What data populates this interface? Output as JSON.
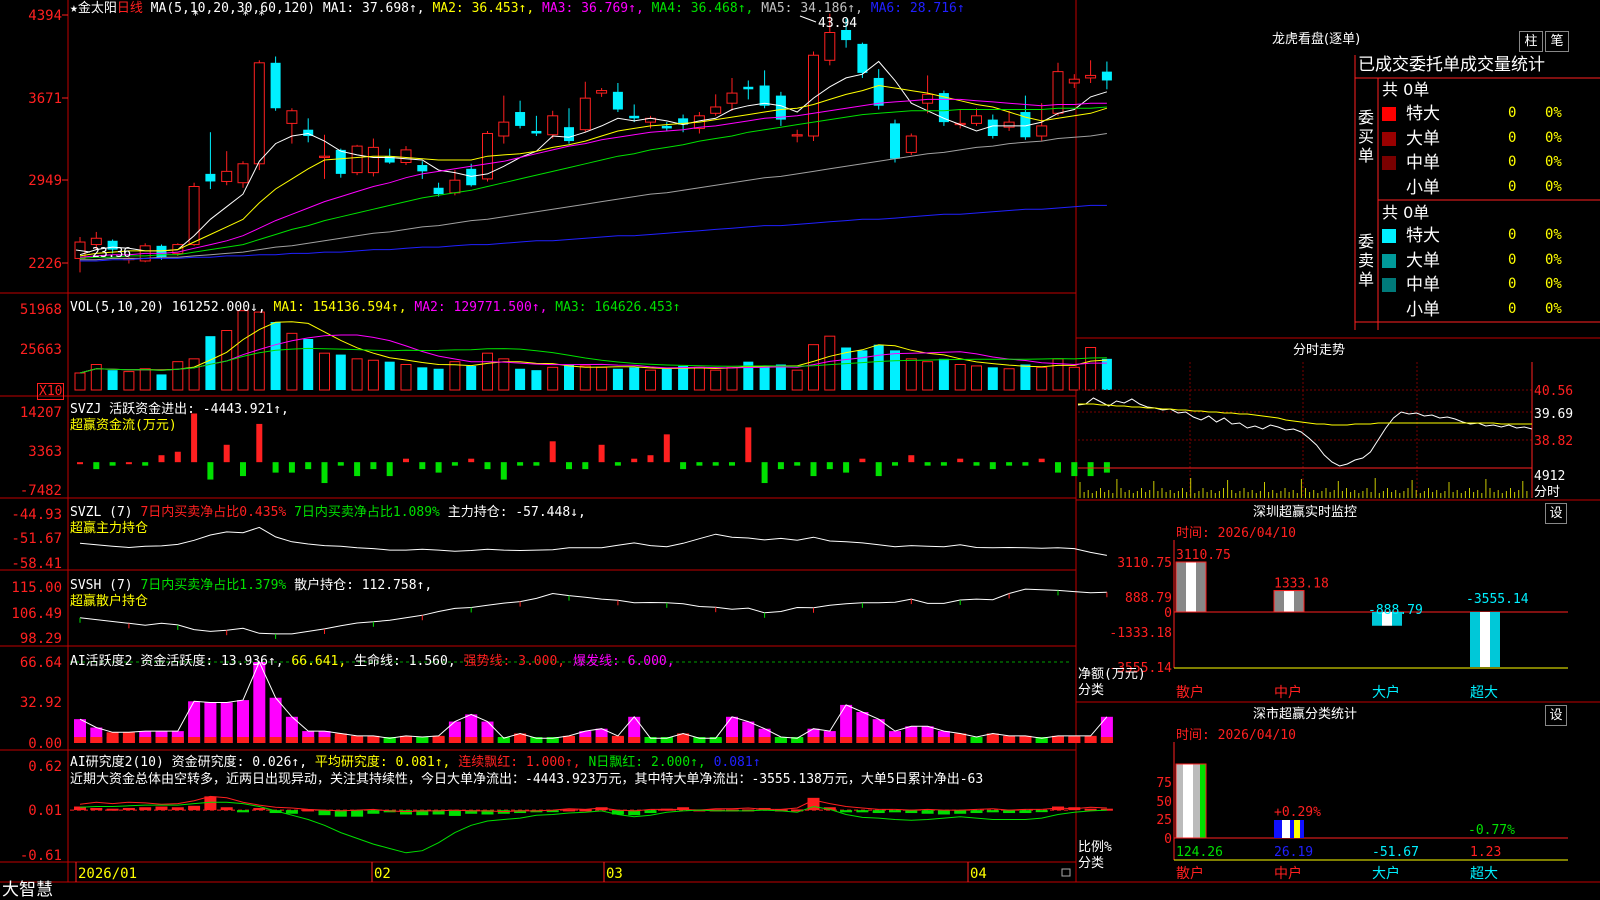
{
  "colors": {
    "red": "#ff2020",
    "cyan": "#00f0ff",
    "green": "#00e000",
    "yellow": "#ffff00",
    "magenta": "#ff00ff",
    "white": "#ffffff",
    "gray": "#a0a0a0",
    "blue": "#2020ff",
    "border": "#c00000"
  },
  "kline": {
    "title": "★金太阳",
    "period": "日线",
    "ma_label": "MA(5,10,20,30,60,120)",
    "ma1": "MA1: 37.698↑,",
    "ma2": "MA2: 36.453↑,",
    "ma3": "MA3: 36.769↑,",
    "ma4": "MA4: 36.468↑,",
    "ma5": "MA5: 34.186↑,",
    "ma6": "MA6: 28.716↑",
    "y_ticks": [
      "4394",
      "3671",
      "2949",
      "2226"
    ],
    "high_mark": "43.94",
    "low_mark": "23.36",
    "candles": [
      {
        "o": 24.5,
        "c": 25.8,
        "h": 26.2,
        "l": 23.4
      },
      {
        "o": 25.6,
        "c": 26.1,
        "h": 26.6,
        "l": 25.2
      },
      {
        "o": 25.9,
        "c": 25.2,
        "h": 26.0,
        "l": 24.9
      },
      {
        "o": 24.4,
        "c": 24.5,
        "h": 24.6,
        "l": 24.1
      },
      {
        "o": 24.3,
        "c": 25.5,
        "h": 25.7,
        "l": 24.2
      },
      {
        "o": 25.5,
        "c": 24.6,
        "h": 25.6,
        "l": 24.4
      },
      {
        "o": 24.9,
        "c": 25.6,
        "h": 25.7,
        "l": 24.7
      },
      {
        "o": 25.6,
        "c": 30.2,
        "h": 30.5,
        "l": 25.5
      },
      {
        "o": 31.2,
        "c": 30.6,
        "h": 34.5,
        "l": 30.0
      },
      {
        "o": 30.6,
        "c": 31.4,
        "h": 33.0,
        "l": 30.3
      },
      {
        "o": 30.5,
        "c": 32.0,
        "h": 32.2,
        "l": 30.1
      },
      {
        "o": 32.0,
        "c": 40.0,
        "h": 40.2,
        "l": 31.5
      },
      {
        "o": 40.0,
        "c": 36.4,
        "h": 40.5,
        "l": 36.2
      },
      {
        "o": 35.2,
        "c": 36.2,
        "h": 36.4,
        "l": 33.6
      },
      {
        "o": 34.7,
        "c": 34.2,
        "h": 35.6,
        "l": 33.7
      },
      {
        "o": 32.5,
        "c": 32.6,
        "h": 34.3,
        "l": 30.8
      },
      {
        "o": 33.1,
        "c": 31.2,
        "h": 33.2,
        "l": 30.9
      },
      {
        "o": 31.3,
        "c": 33.4,
        "h": 33.5,
        "l": 31.1
      },
      {
        "o": 31.3,
        "c": 33.3,
        "h": 34.0,
        "l": 31.0
      },
      {
        "o": 32.6,
        "c": 32.1,
        "h": 33.2,
        "l": 32.0
      },
      {
        "o": 32.1,
        "c": 33.1,
        "h": 33.4,
        "l": 31.9
      },
      {
        "o": 31.9,
        "c": 31.4,
        "h": 32.2,
        "l": 30.8
      },
      {
        "o": 30.1,
        "c": 29.6,
        "h": 30.5,
        "l": 29.4
      },
      {
        "o": 29.7,
        "c": 30.7,
        "h": 31.5,
        "l": 29.5
      },
      {
        "o": 31.6,
        "c": 30.3,
        "h": 32.0,
        "l": 30.2
      },
      {
        "o": 30.8,
        "c": 34.4,
        "h": 34.6,
        "l": 30.6
      },
      {
        "o": 34.2,
        "c": 35.3,
        "h": 37.4,
        "l": 33.6
      },
      {
        "o": 36.1,
        "c": 35.0,
        "h": 37.0,
        "l": 34.8
      },
      {
        "o": 34.6,
        "c": 34.4,
        "h": 35.8,
        "l": 34.2
      },
      {
        "o": 34.3,
        "c": 35.8,
        "h": 36.2,
        "l": 34.0
      },
      {
        "o": 34.9,
        "c": 33.8,
        "h": 36.4,
        "l": 33.6
      },
      {
        "o": 34.7,
        "c": 37.2,
        "h": 38.5,
        "l": 34.5
      },
      {
        "o": 37.6,
        "c": 37.8,
        "h": 38.0,
        "l": 37.3
      },
      {
        "o": 37.7,
        "c": 36.3,
        "h": 38.4,
        "l": 36.1
      },
      {
        "o": 35.8,
        "c": 35.6,
        "h": 36.7,
        "l": 35.3
      },
      {
        "o": 35.3,
        "c": 35.6,
        "h": 35.8,
        "l": 34.8
      },
      {
        "o": 35.0,
        "c": 34.8,
        "h": 35.3,
        "l": 34.6
      },
      {
        "o": 35.6,
        "c": 35.1,
        "h": 35.9,
        "l": 34.5
      },
      {
        "o": 34.8,
        "c": 35.8,
        "h": 36.1,
        "l": 34.4
      },
      {
        "o": 36.0,
        "c": 36.5,
        "h": 37.5,
        "l": 35.8
      },
      {
        "o": 36.8,
        "c": 37.6,
        "h": 38.8,
        "l": 36.2
      },
      {
        "o": 38.1,
        "c": 37.9,
        "h": 38.6,
        "l": 37.1
      },
      {
        "o": 38.2,
        "c": 36.6,
        "h": 39.4,
        "l": 36.4
      },
      {
        "o": 37.4,
        "c": 35.5,
        "h": 37.7,
        "l": 35.0
      },
      {
        "o": 34.2,
        "c": 34.3,
        "h": 34.7,
        "l": 33.7
      },
      {
        "o": 34.2,
        "c": 40.6,
        "h": 40.9,
        "l": 33.8
      },
      {
        "o": 40.2,
        "c": 42.4,
        "h": 43.9,
        "l": 39.8
      },
      {
        "o": 42.6,
        "c": 41.8,
        "h": 43.5,
        "l": 41.2
      },
      {
        "o": 41.5,
        "c": 39.2,
        "h": 41.6,
        "l": 38.8
      },
      {
        "o": 38.8,
        "c": 36.6,
        "h": 39.5,
        "l": 36.3
      },
      {
        "o": 35.2,
        "c": 32.4,
        "h": 35.5,
        "l": 32.1
      },
      {
        "o": 32.9,
        "c": 34.2,
        "h": 34.4,
        "l": 32.7
      },
      {
        "o": 36.8,
        "c": 37.5,
        "h": 39.0,
        "l": 36.0
      },
      {
        "o": 37.6,
        "c": 35.3,
        "h": 37.8,
        "l": 35.0
      },
      {
        "o": 35.1,
        "c": 35.2,
        "h": 36.3,
        "l": 34.8
      },
      {
        "o": 35.2,
        "c": 35.8,
        "h": 36.4,
        "l": 35.0
      },
      {
        "o": 35.5,
        "c": 34.2,
        "h": 35.9,
        "l": 34.0
      },
      {
        "o": 34.9,
        "c": 35.3,
        "h": 36.2,
        "l": 34.6
      },
      {
        "o": 36.1,
        "c": 34.1,
        "h": 37.4,
        "l": 33.9
      },
      {
        "o": 34.2,
        "c": 35.0,
        "h": 36.8,
        "l": 33.8
      },
      {
        "o": 36.0,
        "c": 39.3,
        "h": 40.0,
        "l": 35.8
      },
      {
        "o": 38.4,
        "c": 38.7,
        "h": 39.1,
        "l": 38.0
      },
      {
        "o": 38.8,
        "c": 39.0,
        "h": 40.2,
        "l": 38.4
      },
      {
        "o": 39.3,
        "c": 38.6,
        "h": 40.1,
        "l": 37.9
      }
    ],
    "ma_lines": {
      "ma5": [
        24.8,
        25.2,
        25.4,
        25.3,
        25.1,
        25.1,
        25.2,
        26.3,
        27.6,
        28.6,
        29.6,
        32.2,
        33.6,
        34.2,
        34.4,
        33.8,
        33.0,
        32.7,
        32.5,
        32.5,
        32.4,
        32.3,
        31.5,
        31.3,
        31.0,
        31.2,
        31.8,
        32.5,
        33.0,
        34.2,
        34.1,
        34.5,
        35.0,
        35.6,
        35.4,
        35.6,
        35.4,
        35.1,
        35.4,
        35.6,
        36.3,
        36.6,
        36.8,
        36.6,
        36.1,
        37.2,
        38.1,
        38.8,
        39.1,
        40.1,
        38.6,
        36.8,
        36.2,
        35.6,
        35.1,
        34.6,
        35.0,
        35.0,
        35.0,
        35.3,
        36.0,
        36.3,
        37.3,
        37.7
      ],
      "ma10": [
        24.7,
        24.9,
        25.0,
        25.1,
        25.1,
        25.1,
        25.2,
        25.8,
        26.4,
        27.0,
        27.6,
        28.9,
        30.0,
        30.8,
        31.6,
        32.3,
        32.4,
        32.5,
        32.6,
        32.6,
        32.5,
        32.4,
        32.3,
        32.3,
        32.3,
        32.6,
        32.7,
        32.8,
        33.0,
        33.3,
        33.5,
        33.8,
        34.2,
        34.6,
        34.8,
        35.0,
        35.1,
        35.2,
        35.3,
        35.5,
        35.7,
        35.9,
        36.1,
        36.3,
        36.4,
        36.7,
        37.1,
        37.5,
        37.8,
        38.2,
        38.0,
        37.8,
        37.6,
        37.3,
        37.0,
        36.7,
        36.5,
        36.1,
        35.7,
        35.4,
        35.6,
        35.8,
        36.0,
        36.4
      ],
      "ma20": [
        24.6,
        24.7,
        24.8,
        24.8,
        24.9,
        24.9,
        25.0,
        25.3,
        25.6,
        25.9,
        26.3,
        26.9,
        27.5,
        28.0,
        28.5,
        29.0,
        29.4,
        29.8,
        30.2,
        30.5,
        30.9,
        31.2,
        31.4,
        31.6,
        31.8,
        32.0,
        32.2,
        32.5,
        32.8,
        33.1,
        33.4,
        33.6,
        33.9,
        34.1,
        34.3,
        34.5,
        34.6,
        34.7,
        34.9,
        35.0,
        35.2,
        35.4,
        35.6,
        35.7,
        35.8,
        36.0,
        36.2,
        36.4,
        36.6,
        36.8,
        36.9,
        37.0,
        37.1,
        37.1,
        37.1,
        37.0,
        36.9,
        36.8,
        36.7,
        36.6,
        36.7,
        36.7,
        36.8,
        36.8
      ],
      "ma30": [
        24.5,
        24.6,
        24.6,
        24.7,
        24.7,
        24.8,
        24.8,
        25.0,
        25.2,
        25.4,
        25.6,
        26.0,
        26.4,
        26.8,
        27.1,
        27.5,
        27.8,
        28.1,
        28.4,
        28.7,
        29.0,
        29.3,
        29.5,
        29.7,
        29.9,
        30.2,
        30.5,
        30.8,
        31.1,
        31.4,
        31.7,
        32.0,
        32.3,
        32.6,
        32.8,
        33.1,
        33.3,
        33.5,
        33.8,
        34.0,
        34.2,
        34.5,
        34.7,
        34.9,
        35.1,
        35.3,
        35.5,
        35.7,
        35.9,
        36.0,
        36.1,
        36.2,
        36.2,
        36.2,
        36.3,
        36.3,
        36.3,
        36.3,
        36.3,
        36.3,
        36.4,
        36.4,
        36.4,
        36.5
      ],
      "ma60": [
        24.4,
        24.4,
        24.5,
        24.5,
        24.5,
        24.6,
        24.6,
        24.7,
        24.8,
        24.9,
        25.0,
        25.2,
        25.4,
        25.5,
        25.7,
        25.9,
        26.1,
        26.3,
        26.5,
        26.6,
        26.8,
        27.0,
        27.1,
        27.3,
        27.5,
        27.6,
        27.8,
        28.0,
        28.2,
        28.4,
        28.6,
        28.8,
        29.0,
        29.2,
        29.4,
        29.6,
        29.7,
        29.9,
        30.1,
        30.3,
        30.5,
        30.7,
        30.9,
        31.0,
        31.2,
        31.4,
        31.6,
        31.8,
        32.0,
        32.2,
        32.4,
        32.6,
        32.8,
        32.9,
        33.1,
        33.3,
        33.4,
        33.6,
        33.7,
        33.8,
        34.0,
        34.1,
        34.2,
        34.4
      ],
      "ma120": [
        24.3,
        24.3,
        24.4,
        24.4,
        24.5,
        24.5,
        24.5,
        24.6,
        24.6,
        24.7,
        24.7,
        24.8,
        24.8,
        24.9,
        24.9,
        25.0,
        25.0,
        25.1,
        25.2,
        25.2,
        25.3,
        25.4,
        25.4,
        25.5,
        25.6,
        25.6,
        25.7,
        25.8,
        25.9,
        25.9,
        26.0,
        26.1,
        26.2,
        26.3,
        26.3,
        26.4,
        26.5,
        26.6,
        26.7,
        26.8,
        26.9,
        27.0,
        27.1,
        27.1,
        27.2,
        27.3,
        27.4,
        27.5,
        27.6,
        27.6,
        27.7,
        27.8,
        27.9,
        28.0,
        28.0,
        28.1,
        28.2,
        28.3,
        28.4,
        28.4,
        28.5,
        28.6,
        28.7,
        28.7
      ]
    }
  },
  "volume": {
    "label": "VOL(5,10,20)",
    "value": "161252.000↓,",
    "ma1": "MA1: 154136.594↑,",
    "ma2": "MA2: 129771.500↑,",
    "ma3": "MA3: 164626.453↑",
    "y_ticks": [
      "51968",
      "25663"
    ],
    "unit": "X10",
    "bars": [
      12,
      18,
      14,
      13,
      15,
      11,
      20,
      22,
      38,
      42,
      56,
      55,
      48,
      40,
      36,
      26,
      25,
      22,
      21,
      20,
      18,
      16,
      15,
      20,
      17,
      26,
      22,
      15,
      14,
      16,
      18,
      17,
      16,
      15,
      16,
      14,
      15,
      17,
      16,
      14,
      16,
      20,
      17,
      18,
      14,
      32,
      38,
      30,
      28,
      32,
      28,
      22,
      20,
      22,
      18,
      17,
      16,
      15,
      18,
      16,
      22,
      16,
      30,
      22
    ]
  },
  "svzj": {
    "label": "SVZJ",
    "name": "活跃资金进出: -4443.921↑,",
    "sub": "超赢资金流(万元)",
    "y_ticks": [
      "14207",
      "3363",
      "-7482"
    ],
    "bars": [
      0,
      -2,
      -1,
      0,
      -1,
      2,
      3,
      14,
      -5,
      5,
      -4,
      11,
      -3,
      -3,
      -2,
      -6,
      -1,
      -4,
      -2,
      -4,
      1,
      -2,
      -3,
      -1,
      1,
      -2,
      -5,
      -1,
      -1,
      6,
      -2,
      -2,
      5,
      -1,
      1,
      2,
      8,
      -2,
      -1,
      -1,
      -1,
      10,
      -6,
      -2,
      -1,
      -4,
      -2,
      -3,
      1,
      -4,
      -1,
      2,
      -1,
      -1,
      1,
      -1,
      -2,
      -1,
      -1,
      1,
      -3,
      -4,
      -4,
      -3
    ]
  },
  "svzl": {
    "label": "SVZL (7)",
    "part1": "7日内买卖净占比0.435%",
    "part2": "7日内买卖净占比1.089%",
    "part3": "主力持仓: -57.448↓,",
    "sub": "超赢主力持仓",
    "y_ticks": [
      "-44.93",
      "-51.67",
      "-58.41"
    ],
    "line": [
      -53.2,
      -53.6,
      -54.0,
      -54.3,
      -54.0,
      -53.9,
      -53.5,
      -52.4,
      -51.0,
      -50.2,
      -50.4,
      -49.0,
      -51.5,
      -52.8,
      -53.4,
      -53.8,
      -54.0,
      -54.4,
      -54.6,
      -55.0,
      -55.0,
      -54.8,
      -55.0,
      -55.3,
      -55.1,
      -54.8,
      -55.0,
      -55.1,
      -55.0,
      -54.9,
      -54.4,
      -54.4,
      -54.4,
      -53.7,
      -53.1,
      -53.8,
      -54.1,
      -53.2,
      -52.0,
      -50.8,
      -51.6,
      -51.8,
      -52.3,
      -51.9,
      -52.4,
      -51.6,
      -52.6,
      -52.8,
      -53.1,
      -53.6,
      -54.1,
      -53.8,
      -54.0,
      -54.1,
      -53.6,
      -54.3,
      -54.4,
      -54.3,
      -54.4,
      -54.5,
      -54.4,
      -54.6,
      -55.6,
      -56.4
    ]
  },
  "svsh": {
    "label": "SVSH (7)",
    "part1": "7日内买卖净占比1.379%",
    "part2": "散户持仓: 112.758↑,",
    "sub": "超赢散户持仓",
    "y_ticks": [
      "115.00",
      "106.49",
      "98.29"
    ],
    "line": [
      104.8,
      104.2,
      103.6,
      103.0,
      102.4,
      103.0,
      102.5,
      101.0,
      100.4,
      100.8,
      101.4,
      99.8,
      99.6,
      99.6,
      100.4,
      101.2,
      102.2,
      103.1,
      103.5,
      104.0,
      104.8,
      105.6,
      106.8,
      107.8,
      108.1,
      108.8,
      109.5,
      110.0,
      111.0,
      112.6,
      111.9,
      111.4,
      110.8,
      110.4,
      109.6,
      109.7,
      109.6,
      109.3,
      108.4,
      108.2,
      107.5,
      107.9,
      106.4,
      106.8,
      108.1,
      108.0,
      108.8,
      109.3,
      109.6,
      109.6,
      109.8,
      110.8,
      109.4,
      109.4,
      110.5,
      110.8,
      110.6,
      112.6,
      114.0,
      113.8,
      113.6,
      113.2,
      112.8,
      113.0,
      112.6,
      112.3,
      112.6,
      113.2
    ]
  },
  "ai1": {
    "label": "AI活跃度2",
    "p1": "资金活跃度: 13.936↑,",
    "p2": "66.641,",
    "p3": "生命线: 1.560,",
    "p4": "强势线: 3.000,",
    "p5": "爆发线: 6.000,",
    "y_ticks": [
      "66.64",
      "32.92",
      "0.00"
    ],
    "bars": [
      20,
      13,
      9,
      9,
      10,
      10,
      10,
      35,
      34,
      34,
      36,
      68,
      38,
      22,
      10,
      10,
      8,
      6,
      6,
      4,
      6,
      5,
      6,
      18,
      24,
      18,
      4,
      8,
      4,
      4,
      6,
      10,
      12,
      6,
      22,
      4,
      4,
      8,
      4,
      4,
      22,
      18,
      12,
      5,
      4,
      12,
      10,
      32,
      26,
      20,
      10,
      14,
      14,
      10,
      8,
      5,
      8,
      6,
      6,
      4,
      6,
      6,
      6,
      22,
      18,
      14,
      14
    ]
  },
  "ai2": {
    "label": "AI研究度2(10)",
    "p1": "资金研究度: 0.026↑,",
    "p2": "平均研究度: 0.081↑,",
    "p3": "连续飘红: 1.000↑,",
    "p4": "N日飘红: 2.000↑,",
    "p5": "0.081↑",
    "comment": "近期大资金总体由空转多，近两日出现异动，关注其持续性，今日大单净流出：-4443.923万元，其中特大单净流出：-3555.138万元，大单5日累计净出-63",
    "y_ticks": [
      "0.62",
      "0.01",
      "-0.61"
    ]
  },
  "xaxis": {
    "labels": [
      "2026/01",
      "02",
      "03",
      "04"
    ]
  },
  "brand": "大智慧",
  "lhb": {
    "title": "龙虎看盘(逐单)",
    "btn1": "柱",
    "btn2": "笔",
    "head": "已成交委托单成交量统计",
    "buy_side": "委买单",
    "sell_side": "委卖单",
    "buy_total": "共 0单",
    "sell_total": "共 0单",
    "rows": [
      "特大",
      "大单",
      "中单",
      "小单"
    ],
    "zero": "0",
    "pct": "0%"
  },
  "intraday": {
    "title": "分时走势",
    "y_ticks": [
      "40.56",
      "39.69",
      "38.82"
    ],
    "vol": "4912",
    "vol_label": "分时"
  },
  "szmon": {
    "title": "深圳超赢实时监控",
    "btn": "设",
    "date": "时间: 2026/04/10",
    "y_ticks": [
      "3110.75",
      "888.79",
      "0",
      "-1333.18",
      "-3555.14"
    ],
    "ylabel": "净额(万元)",
    "xlabel": "分类",
    "cats": [
      "散户",
      "中户",
      "大户",
      "超大"
    ],
    "values": [
      "3110.75",
      "1333.18",
      "-888.79",
      "-3555.14"
    ]
  },
  "szcls": {
    "title": "深市超赢分类统计",
    "btn": "设",
    "date": "时间: 2026/04/10",
    "y_ticks": [
      "75",
      "50",
      "25",
      "0"
    ],
    "ylabel": "比例%",
    "xlabel": "分类",
    "cats": [
      "散户",
      "中户",
      "大户",
      "超大"
    ],
    "bottom_vals": [
      "124.26",
      "26.19",
      "-51.67",
      "1.23"
    ],
    "pct_labels": [
      "+0.29%",
      "-0.77%"
    ]
  }
}
